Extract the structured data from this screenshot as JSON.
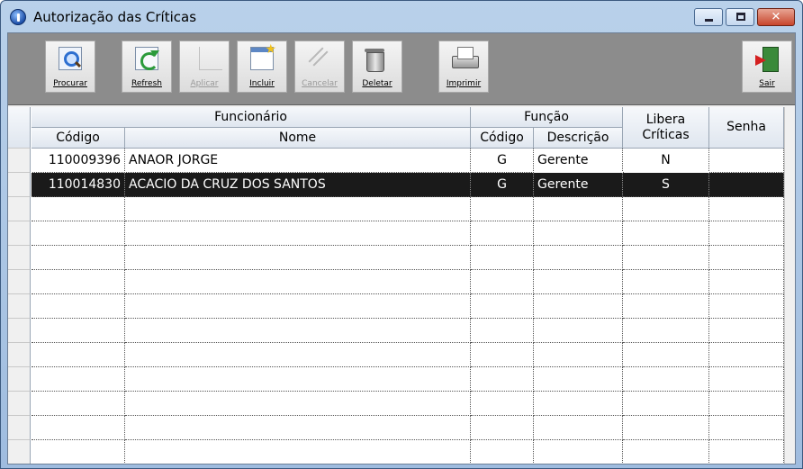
{
  "window": {
    "title": "Autorização das Críticas",
    "close_glyph": "✕"
  },
  "toolbar": {
    "buttons": [
      {
        "label": "Procurar",
        "icon": "search-icon",
        "enabled": true
      },
      {
        "label": "Refresh",
        "icon": "refresh-icon",
        "enabled": true
      },
      {
        "label": "Aplicar",
        "icon": "apply-icon",
        "enabled": false
      },
      {
        "label": "Incluir",
        "icon": "add-icon",
        "enabled": true
      },
      {
        "label": "Cancelar",
        "icon": "cancel-icon",
        "enabled": false
      },
      {
        "label": "Deletar",
        "icon": "trash-icon",
        "enabled": true
      },
      {
        "label": "Imprimir",
        "icon": "printer-icon",
        "enabled": true
      },
      {
        "label": "Sair",
        "icon": "exit-icon",
        "enabled": true
      }
    ]
  },
  "grid": {
    "group_headers": {
      "funcionario": "Funcionário",
      "funcao": "Função",
      "libera_criticas": "Libera Críticas",
      "senha": "Senha"
    },
    "column_headers": {
      "codigo": "Código",
      "nome": "Nome",
      "funcao_codigo": "Código",
      "descricao": "Descrição"
    },
    "rows": [
      {
        "codigo": "110009396",
        "nome": "ANAOR JORGE",
        "funcao_codigo": "G",
        "descricao": "Gerente",
        "libera": "N",
        "senha": "",
        "selected": false
      },
      {
        "codigo": "110014830",
        "nome": "ACACIO DA CRUZ DOS SANTOS",
        "funcao_codigo": "G",
        "descricao": "Gerente",
        "libera": "S",
        "senha": "",
        "selected": true
      }
    ],
    "empty_rows": 11
  },
  "colors": {
    "title_bar": "#b9d1ea",
    "toolbar_bg": "#8c8c8c",
    "selected_row": "#1a1a1a",
    "close_button": "#c7452c"
  }
}
